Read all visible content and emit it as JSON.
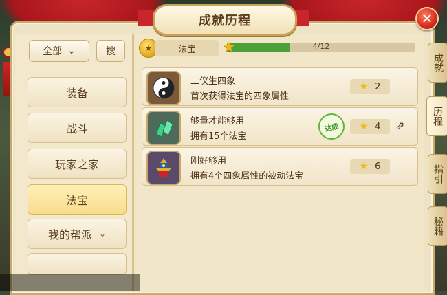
{
  "window": {
    "title": "成就历程",
    "close_label": "✕"
  },
  "sidebar": {
    "filter": {
      "selected": "全部",
      "chevron": "⌄"
    },
    "search_label": "搜",
    "categories": [
      {
        "label": "装备"
      },
      {
        "label": "战斗"
      },
      {
        "label": "玩家之家"
      },
      {
        "label": "法宝",
        "selected": true
      },
      {
        "label": "我的帮派",
        "dropdown": true
      }
    ]
  },
  "summary": {
    "category": "法宝",
    "progress_current": 4,
    "progress_total": 12,
    "progress_text": "4/12"
  },
  "achievements": [
    {
      "name": "二仪生四象",
      "desc": "首次获得法宝的四象属性",
      "reward": "2",
      "icon": "yin-yang-icon",
      "completed": false
    },
    {
      "name": "够量才能够用",
      "desc": "拥有15个法宝",
      "reward": "4",
      "icon": "jade-crystal-icon",
      "completed": true,
      "stamp": "达成"
    },
    {
      "name": "刚好够用",
      "desc": "拥有4个四象属性的被动法宝",
      "reward": "6",
      "icon": "pagoda-icon",
      "completed": false
    }
  ],
  "side_tabs": [
    {
      "label": "成就"
    },
    {
      "label": "历程",
      "active": true
    },
    {
      "label": "指引"
    },
    {
      "label": "秘籍"
    }
  ],
  "colors": {
    "progress": "#4aa236",
    "accent_red": "#c8262a",
    "star": "#f2b818"
  }
}
